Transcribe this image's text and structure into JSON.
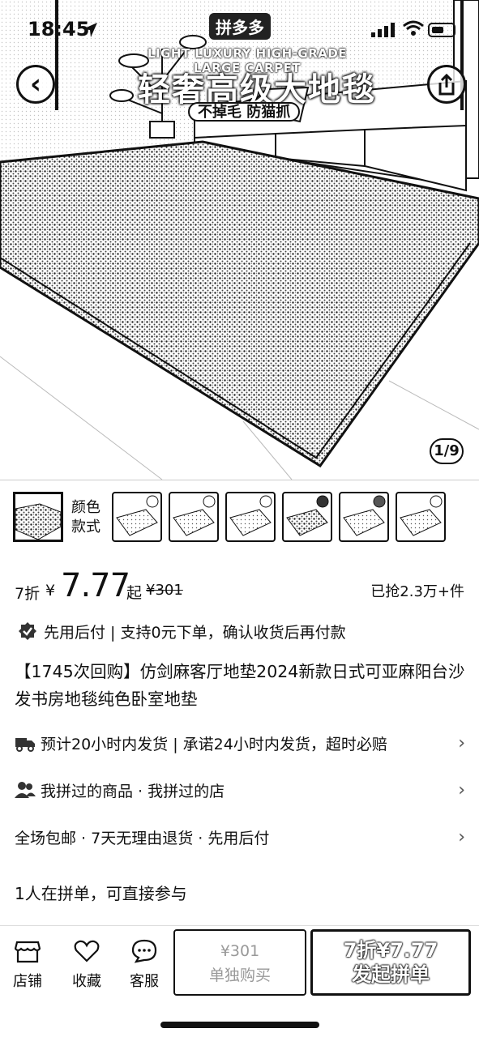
{
  "status_bar": {
    "time": "18:45"
  },
  "hero": {
    "brand": "拼多多",
    "en_title": "LIGHT LUXURY HIGH-GRADE LARGE CARPET",
    "cn_title": "轻奢高级大地毯",
    "badge": "不掉毛 防猫抓",
    "counter": "1/9",
    "back_label": "‹"
  },
  "variants": {
    "label_line1": "颜色",
    "label_line2": "款式",
    "thumb_count": 6
  },
  "price": {
    "discount": "7折",
    "yen": "¥",
    "value": "7.77",
    "suffix": "起",
    "original": "¥301",
    "sold": "已抢2.3万+件"
  },
  "pay_later": "先用后付 | 支持0元下单，确认收货后再付款",
  "product_title": "【1745次回购】仿剑麻客厅地垫2024新款日式可亚麻阳台沙发书房地毯纯色卧室地垫",
  "info_rows": {
    "shipping": "预计20小时内发货 | 承诺24小时内发货，超时必赔",
    "history": "我拼过的商品 · 我拼过的店",
    "service": "全场包邮 · 7天无理由退货 · 先用后付"
  },
  "group_buy": "1人在拼单，可直接参与",
  "bottom_bar": {
    "store": "店铺",
    "favorite": "收藏",
    "service": "客服",
    "solo_price": "¥301",
    "solo_label": "单独购买",
    "group_price": "7折¥7.77",
    "group_label": "发起拼单"
  }
}
